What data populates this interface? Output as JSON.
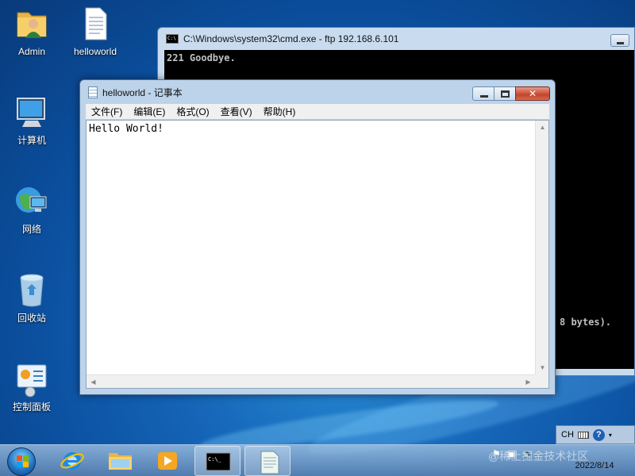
{
  "desktop": {
    "icons": [
      {
        "label": "Admin",
        "icon": "user-folder-icon"
      },
      {
        "label": "helloworld",
        "icon": "text-file-icon"
      },
      {
        "label": "计算机",
        "icon": "computer-icon"
      },
      {
        "label": "网络",
        "icon": "network-icon"
      },
      {
        "label": "回收站",
        "icon": "recycle-bin-icon"
      },
      {
        "label": "控制面板",
        "icon": "control-panel-icon"
      }
    ]
  },
  "cmd_window": {
    "title": "C:\\Windows\\system32\\cmd.exe - ftp  192.168.6.101",
    "lines": [
      "221 Goodbye.",
      "8 bytes)."
    ]
  },
  "notepad": {
    "title": "helloworld - 记事本",
    "menu": [
      "文件(F)",
      "编辑(E)",
      "格式(O)",
      "查看(V)",
      "帮助(H)"
    ],
    "content": "Hello World!"
  },
  "language_bar": {
    "lang": "CH",
    "help": "?"
  },
  "taskbar": {
    "pinned": [
      "ie-icon",
      "explorer-icon",
      "media-player-icon",
      "cmd-icon",
      "notepad-icon"
    ],
    "tray_icons": [
      "flag-icon",
      "network-icon",
      "volume-icon"
    ],
    "date": "2022/8/14",
    "watermark": "@稀土掘金技术社区"
  },
  "colors": {
    "desktop_blue": "#1565b8",
    "close_red": "#c2452c",
    "console_bg": "#000000"
  }
}
